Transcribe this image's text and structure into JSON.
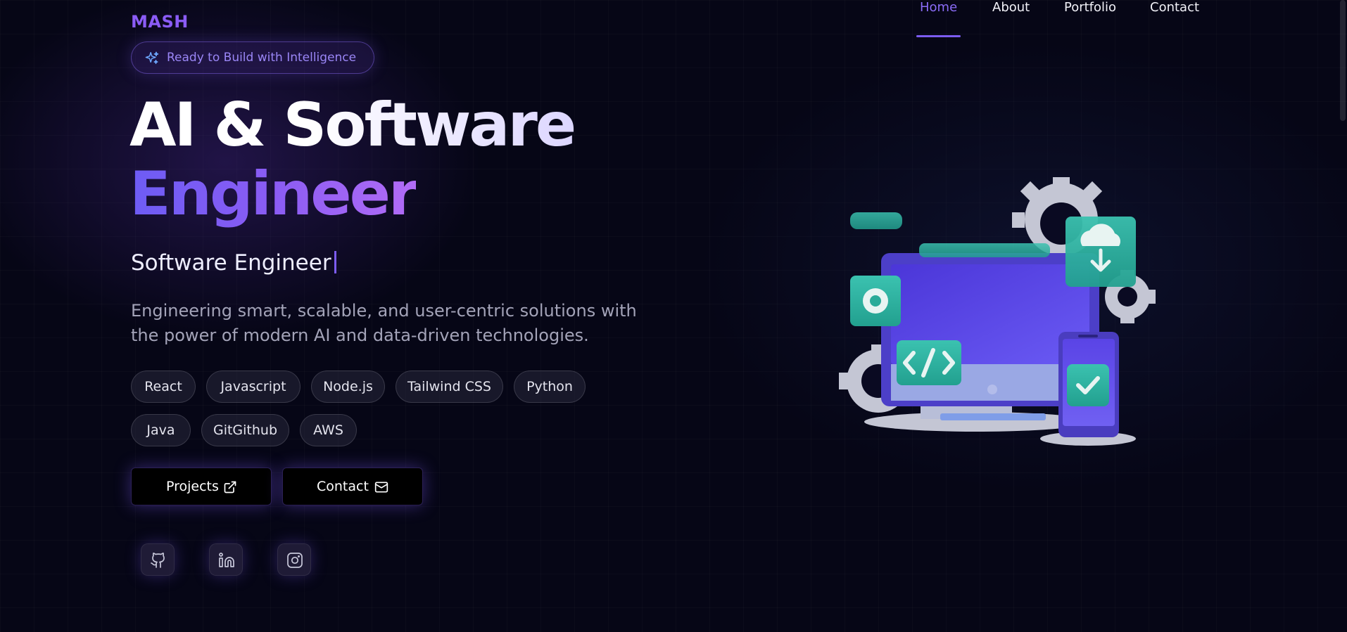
{
  "brand": {
    "logo": "MASH"
  },
  "nav": {
    "items": [
      "Home",
      "About",
      "Portfolio",
      "Contact"
    ],
    "active": "Home"
  },
  "hero": {
    "badge": "Ready to Build with Intelligence",
    "title_line1": "AI & Software",
    "title_line2": "Engineer",
    "typed_role": "Software Engineer",
    "description": "Engineering smart, scalable, and user-centric solutions with the power of modern AI and data-driven technologies.",
    "tags": [
      "React",
      "Javascript",
      "Node.js",
      "Tailwind CSS",
      "Python",
      "Java",
      "GitGithub",
      "AWS"
    ],
    "buttons": {
      "projects": "Projects",
      "contact": "Contact"
    }
  },
  "social": [
    "github-icon",
    "linkedin-icon",
    "instagram-icon"
  ],
  "colors": {
    "accent": "#7c5cf0",
    "background": "#060616",
    "teal": "#2bb8a6"
  }
}
